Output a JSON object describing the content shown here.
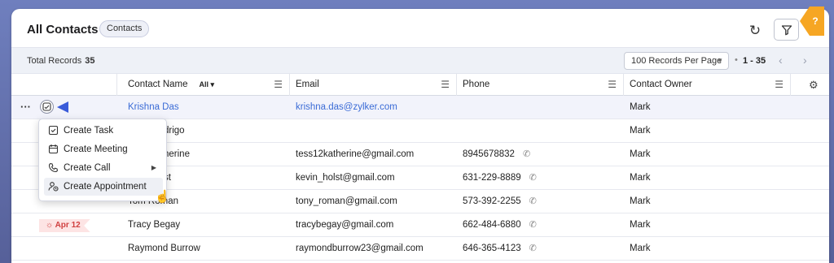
{
  "header": {
    "title": "All Contacts",
    "view_pill": "Contacts",
    "refresh_icon": "refresh-icon",
    "filter_icon": "filter-icon",
    "help_mark": "?"
  },
  "toolbar": {
    "total_label": "Total Records",
    "total_value": "35",
    "per_page": "100 Records Per Page",
    "range": "1 - 35"
  },
  "columns": {
    "name": "Contact Name",
    "name_filter": "All",
    "email": "Email",
    "phone": "Phone",
    "owner": "Contact Owner"
  },
  "rows": [
    {
      "name": "Krishna Das",
      "email": "krishna.das@zylker.com",
      "phone": "",
      "owner": "Mark"
    },
    {
      "name": "drigo",
      "email": "",
      "phone": "",
      "owner": "Mark"
    },
    {
      "name": "herine",
      "email": "tess12katherine@gmail.com",
      "phone": "8945678832",
      "owner": "Mark"
    },
    {
      "name": "st",
      "email": "kevin_holst@gmail.com",
      "phone": "631-229-8889",
      "owner": "Mark"
    },
    {
      "name": "Tom Roman",
      "email": "tony_roman@gmail.com",
      "phone": "573-392-2255",
      "owner": "Mark"
    },
    {
      "name": "Tracy Begay",
      "email": "tracybegay@gmail.com",
      "phone": "662-484-6880",
      "owner": "Mark",
      "tag": "Apr 12"
    },
    {
      "name": "Raymond Burrow",
      "email": "raymondburrow23@gmail.com",
      "phone": "646-365-4123",
      "owner": "Mark"
    }
  ],
  "context_menu": {
    "items": [
      {
        "label": "Create Task",
        "icon": "task-icon"
      },
      {
        "label": "Create Meeting",
        "icon": "calendar-icon"
      },
      {
        "label": "Create Call",
        "icon": "phone-icon",
        "has_submenu": true
      },
      {
        "label": "Create Appointment",
        "icon": "appointment-icon",
        "hover": true
      }
    ]
  },
  "colors": {
    "link": "#3a6bd6",
    "accent": "#3a5bd9",
    "tag_bg": "#fde4e4",
    "tag_text": "#d04040",
    "help": "#f6a623"
  }
}
